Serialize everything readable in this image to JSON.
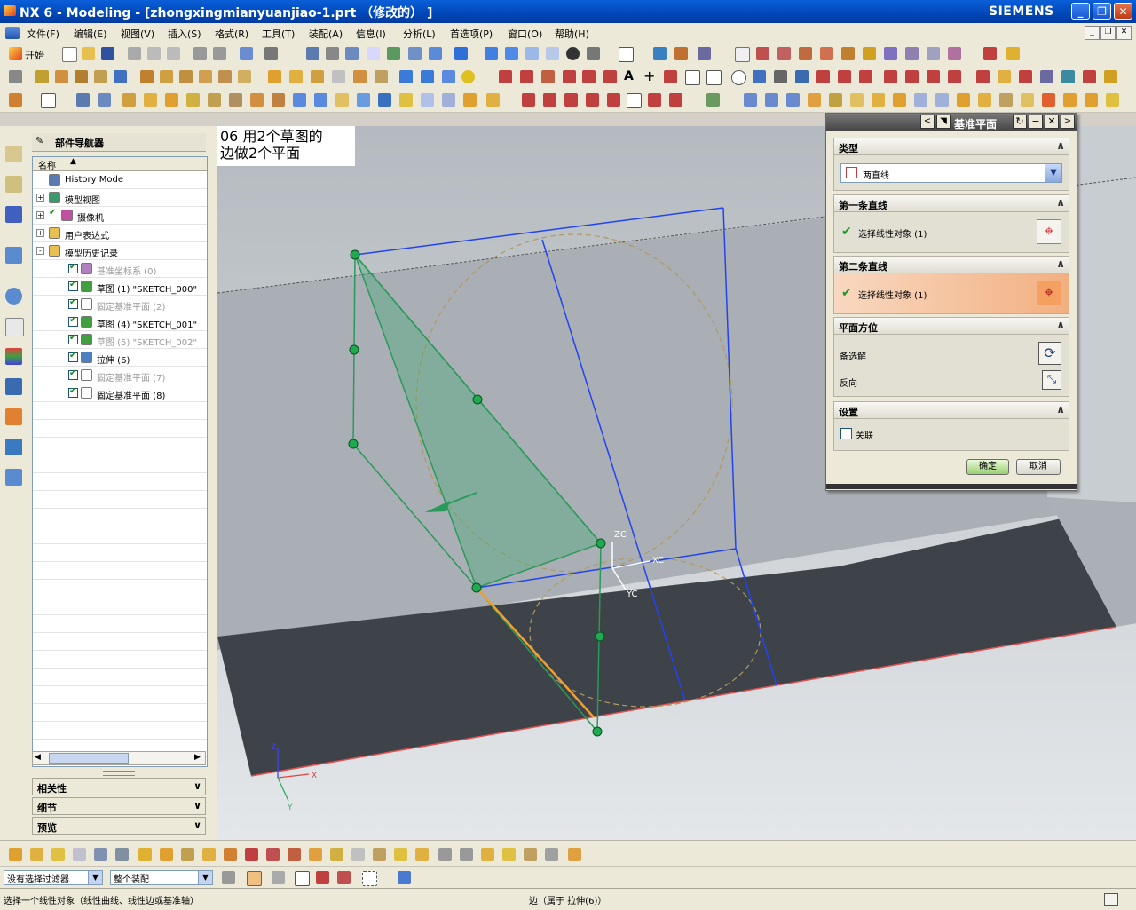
{
  "window": {
    "title": "NX 6 - Modeling - [zhongxingmianyuanjiao-1.prt （修改的） ]",
    "brand": "SIEMENS"
  },
  "menu": [
    "文件(F)",
    "编辑(E)",
    "视图(V)",
    "插入(S)",
    "格式(R)",
    "工具(T)",
    "装配(A)",
    "信息(I)",
    "分析(L)",
    "首选项(P)",
    "窗口(O)",
    "帮助(H)"
  ],
  "toolbar": {
    "start_label": "开始"
  },
  "navigator": {
    "title": "部件导航器",
    "column_header": "名称",
    "rows": [
      {
        "label": "History Mode",
        "icon": "clock-icon",
        "indent": 0,
        "checked": null,
        "expander": null,
        "dim": false
      },
      {
        "label": "模型视图",
        "icon": "model-views-icon",
        "indent": 0,
        "checked": null,
        "expander": "+",
        "dim": false
      },
      {
        "label": "摄像机",
        "icon": "camera-icon",
        "indent": 0,
        "checked": true,
        "expander": "+",
        "dim": false
      },
      {
        "label": "用户表达式",
        "icon": "folder-icon",
        "indent": 0,
        "checked": null,
        "expander": "+",
        "dim": false
      },
      {
        "label": "模型历史记录",
        "icon": "folder-icon",
        "indent": 0,
        "checked": null,
        "expander": "-",
        "dim": false
      },
      {
        "label": "基准坐标系 (0)",
        "icon": "datum-csys-icon",
        "indent": 1,
        "checked": true,
        "expander": null,
        "dim": true
      },
      {
        "label": "草图 (1) \"SKETCH_000\"",
        "icon": "sketch-icon",
        "indent": 1,
        "checked": true,
        "expander": null,
        "dim": false
      },
      {
        "label": "固定基准平面 (2)",
        "icon": "datum-plane-icon",
        "indent": 1,
        "checked": true,
        "expander": null,
        "dim": true
      },
      {
        "label": "草图 (4) \"SKETCH_001\"",
        "icon": "sketch-icon",
        "indent": 1,
        "checked": true,
        "expander": null,
        "dim": false
      },
      {
        "label": "草图 (5) \"SKETCH_002\"",
        "icon": "sketch-icon",
        "indent": 1,
        "checked": true,
        "expander": null,
        "dim": true
      },
      {
        "label": "拉伸 (6)",
        "icon": "extrude-icon",
        "indent": 1,
        "checked": true,
        "expander": null,
        "dim": false
      },
      {
        "label": "固定基准平面 (7)",
        "icon": "datum-plane-icon",
        "indent": 1,
        "checked": true,
        "expander": null,
        "dim": true
      },
      {
        "label": "固定基准平面 (8)",
        "icon": "datum-plane-icon",
        "indent": 1,
        "checked": true,
        "expander": null,
        "dim": false
      }
    ],
    "panels": [
      "相关性",
      "细节",
      "预览"
    ]
  },
  "annotation": {
    "line1": "06 用2个草图的",
    "line2": "边做2个平面"
  },
  "viewport": {
    "axis": {
      "zc": "ZC",
      "xc": "XC",
      "yc": "YC",
      "x": "X",
      "y": "Y",
      "z": "Z"
    }
  },
  "dialog": {
    "title": "基准平面",
    "sections": {
      "type": {
        "header": "类型",
        "value": "两直线"
      },
      "first_line": {
        "header": "第一条直线",
        "select": "选择线性对象 (1)"
      },
      "second_line": {
        "header": "第二条直线",
        "select": "选择线性对象 (1)"
      },
      "orientation": {
        "header": "平面方位",
        "alternate": "备选解",
        "reverse": "反向"
      },
      "settings": {
        "header": "设置",
        "associative": "关联"
      }
    },
    "ok": "确定",
    "cancel": "取消"
  },
  "filters": {
    "selection_filter": "没有选择过滤器",
    "scope": "整个装配"
  },
  "status": {
    "prompt": "选择一个线性对象（线性曲线、线性边或基准轴）",
    "info": "边（属于 拉伸(6)）"
  },
  "colors": {
    "title_blue": "#0a5fd8",
    "plane_green": "#2a9a5a",
    "edge_blue": "#2244ee",
    "edge_orange": "#f0a030",
    "highlight_orange": "#f2b081"
  }
}
